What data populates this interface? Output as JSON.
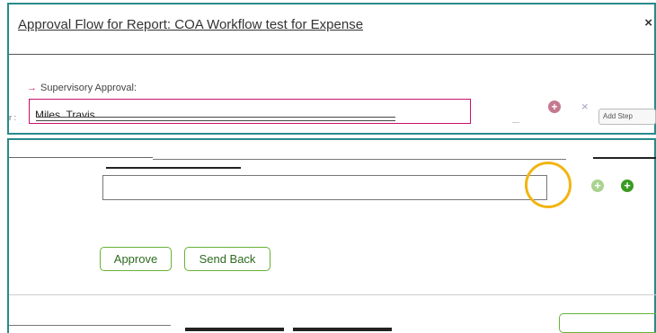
{
  "dialog": {
    "title": "Approval Flow for Report: COA Workflow test for Expense",
    "close_label": "×"
  },
  "supervisory": {
    "label": "Supervisory Approval:",
    "value": "Miles, Travis",
    "arrow_icon": "→",
    "add_icon": "+",
    "remove_icon": "×",
    "side_button_label": "Add Step"
  },
  "approver": {
    "field_value": "",
    "add_icon_1": "+",
    "add_icon_2": "+"
  },
  "actions": {
    "approve_label": "Approve",
    "send_back_label": "Send Back"
  },
  "colors": {
    "border_teal": "#2a8a8a",
    "highlight_yellow": "#f2b410",
    "accent_green": "#66b234",
    "pink": "#c8106e"
  }
}
